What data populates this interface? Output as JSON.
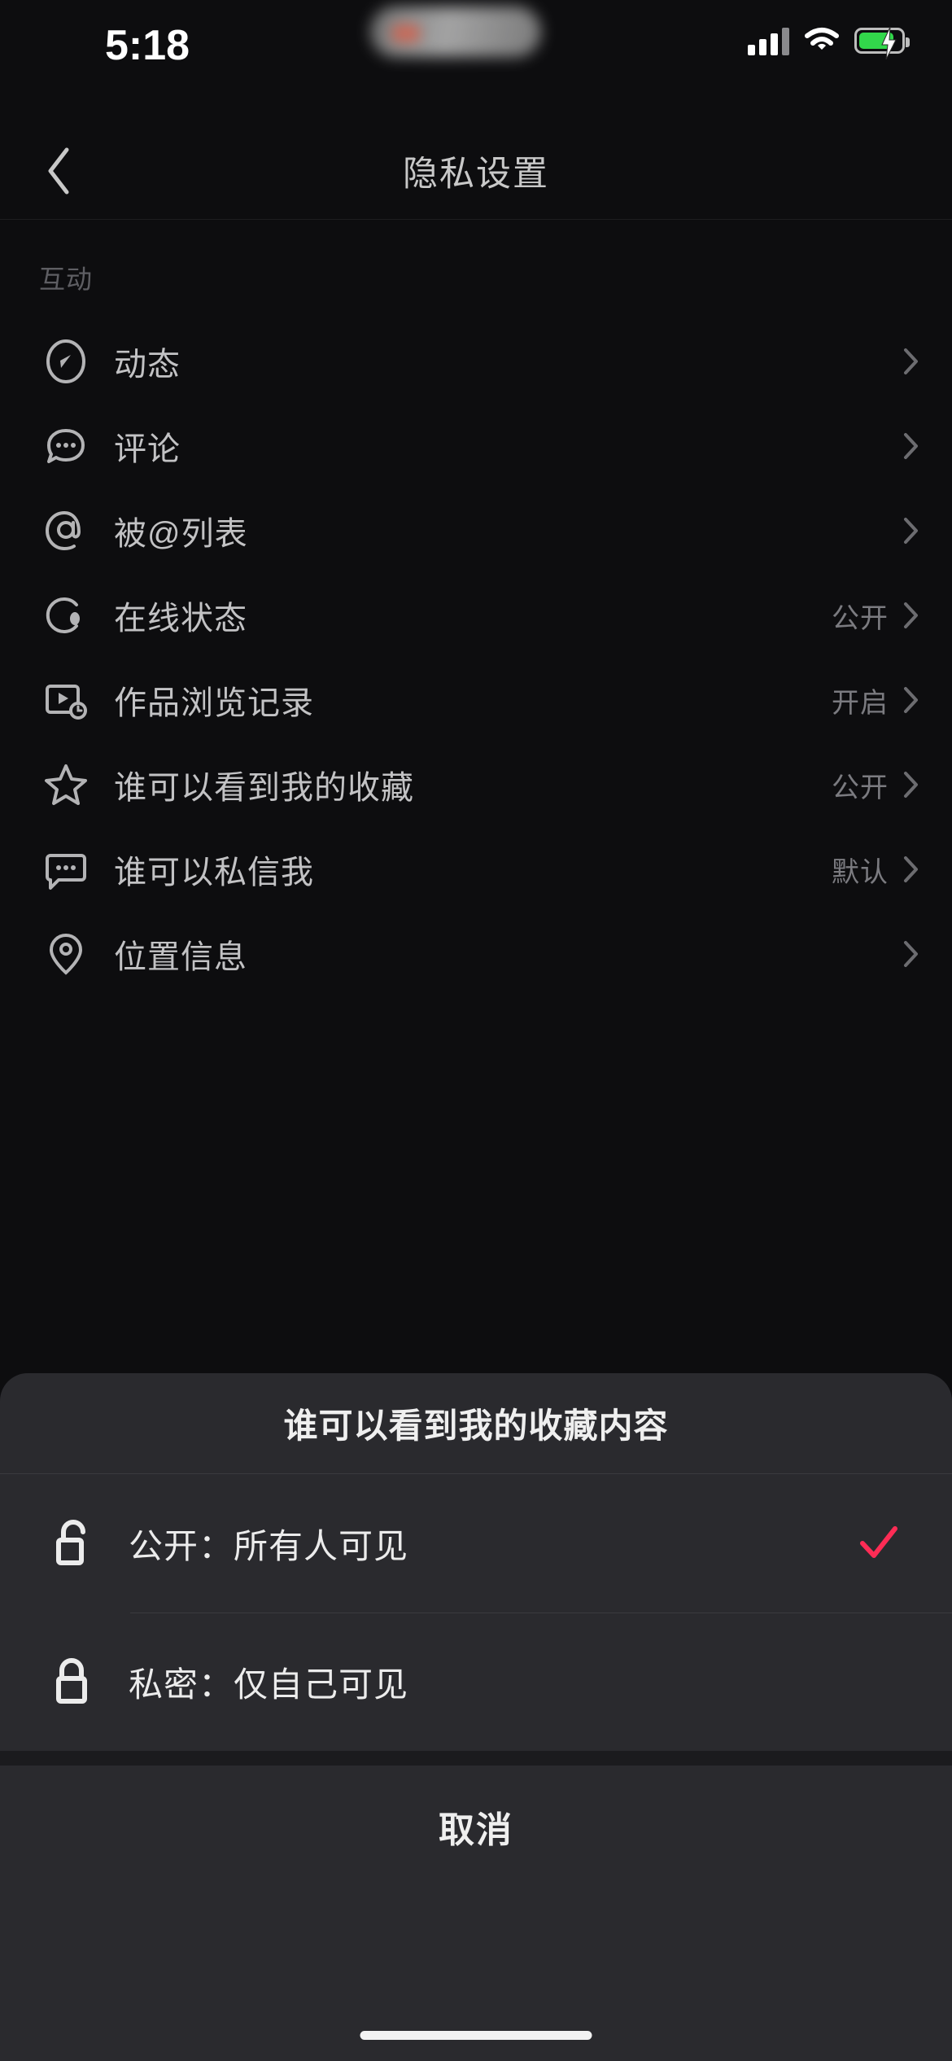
{
  "status_bar": {
    "time": "5:18",
    "cellular_icon": "cellular-signal-icon",
    "wifi_icon": "wifi-icon",
    "battery_icon": "battery-charging-icon"
  },
  "header": {
    "back_icon": "chevron-left-icon",
    "title": "隐私设置"
  },
  "list": {
    "section_label": "互动",
    "rows": [
      {
        "icon": "compass-icon",
        "label": "动态",
        "value": ""
      },
      {
        "icon": "comment-bubble-icon",
        "label": "评论",
        "value": ""
      },
      {
        "icon": "at-mention-icon",
        "label": "被@列表",
        "value": ""
      },
      {
        "icon": "online-status-icon",
        "label": "在线状态",
        "value": "公开"
      },
      {
        "icon": "watch-history-icon",
        "label": "作品浏览记录",
        "value": "开启"
      },
      {
        "icon": "star-icon",
        "label": "谁可以看到我的收藏",
        "value": "公开"
      },
      {
        "icon": "message-icon",
        "label": "谁可以私信我",
        "value": "默认"
      },
      {
        "icon": "location-icon",
        "label": "位置信息",
        "value": ""
      }
    ]
  },
  "action_sheet": {
    "title": "谁可以看到我的收藏内容",
    "options": [
      {
        "icon": "unlock-icon",
        "label": "公开：所有人可见",
        "selected": true
      },
      {
        "icon": "lock-icon",
        "label": "私密：仅自己可见",
        "selected": false
      }
    ],
    "cancel_label": "取消",
    "check_icon": "check-icon",
    "accent_color": "#FE2C55"
  }
}
